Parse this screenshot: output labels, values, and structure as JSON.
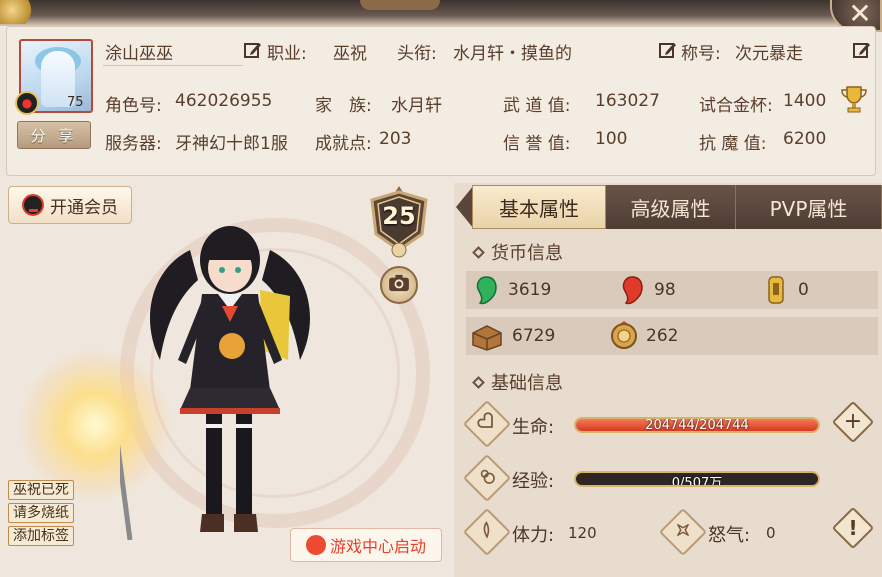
{
  "window": {
    "close_glyph": "✕"
  },
  "profile": {
    "name": "涂山巫巫",
    "avatar_level": "75",
    "share_label": "分 享",
    "job_label": "职业:",
    "job_value": "巫祝",
    "title_label": "头衔:",
    "title_value": "水月轩・摸鱼的",
    "nickname_label": "称号:",
    "nickname_value": "次元暴走",
    "role_id_label": "角色号:",
    "role_id_value": "462026955",
    "clan_label": "家　族:",
    "clan_value": "水月轩",
    "wudao_label": "武 道 值:",
    "wudao_value": "163027",
    "cup_label": "试合金杯:",
    "cup_value": "1400",
    "server_label": "服务器:",
    "server_value": "牙神幻十郎1服",
    "achievement_label": "成就点:",
    "achievement_value": "203",
    "credit_label": "信 誉 值:",
    "credit_value": "100",
    "antimagic_label": "抗 魔 值:",
    "antimagic_value": "6200"
  },
  "character": {
    "vip_label": "开通会员",
    "level": "25",
    "tags": [
      "巫祝已死",
      "请多烧纸",
      "添加标签"
    ],
    "game_center_label": "游戏中心启动"
  },
  "tabs": [
    {
      "label": "基本属性",
      "active": true
    },
    {
      "label": "高级属性",
      "active": false
    },
    {
      "label": "PVP属性",
      "active": false
    }
  ],
  "currency": {
    "section_title": "货币信息",
    "green_jade": "3619",
    "red_jade": "98",
    "gold_token": "0",
    "wood_crate": "6729",
    "coin": "262"
  },
  "basic": {
    "section_title": "基础信息",
    "hp_label": "生命:",
    "hp_text": "204744/204744",
    "hp_fraction": 1.0,
    "exp_label": "经验:",
    "exp_text": "0/507万",
    "exp_fraction": 0.0,
    "stamina_label": "体力:",
    "stamina_value": "120",
    "rage_label": "怒气:",
    "rage_value": "0"
  },
  "colors": {
    "hp_bar": "#e0462c",
    "accent_gold": "#d8b46a",
    "text_brown": "#5a3e2b"
  }
}
